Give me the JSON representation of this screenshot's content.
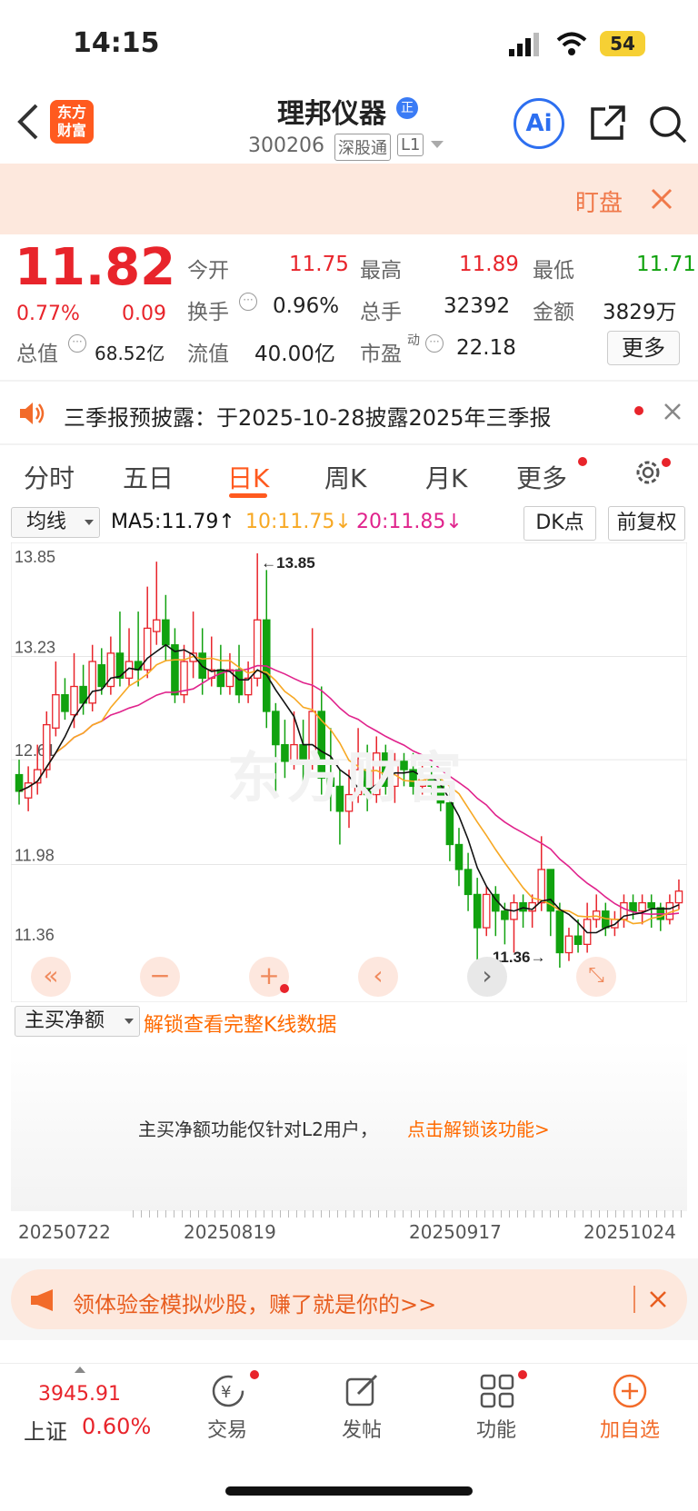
{
  "status_bar": {
    "time": "14:15",
    "battery": "54"
  },
  "header": {
    "title": "理邦仪器",
    "badge": "正",
    "code": "300206",
    "tag1": "深股通",
    "tag2": "L1",
    "logo_line1": "东方",
    "logo_line2": "财富",
    "ai_label": "Ai"
  },
  "banner": {
    "label": "盯盘"
  },
  "quote": {
    "price": "11.82",
    "change_pct": "0.77%",
    "change": "0.09",
    "open_label": "今开",
    "open": "11.75",
    "high_label": "最高",
    "high": "11.89",
    "low_label": "最低",
    "low": "11.71",
    "turnover_label": "换手",
    "turnover": "0.96%",
    "volume_label": "总手",
    "volume": "32392",
    "amount_label": "金额",
    "amount": "3829万",
    "mktcap_label": "总值",
    "mktcap": "68.52亿",
    "float_label": "流值",
    "float": "40.00亿",
    "pe_label": "市盈",
    "pe_sup": "动",
    "pe": "22.18",
    "more_label": "更多"
  },
  "notice": {
    "text": "三季报预披露：于2025-10-28披露2025年三季报"
  },
  "tabs": [
    {
      "label": "分时"
    },
    {
      "label": "五日"
    },
    {
      "label": "日K"
    },
    {
      "label": "周K"
    },
    {
      "label": "月K"
    },
    {
      "label": "更多"
    }
  ],
  "chart_toolbar": {
    "ma_select": "均线",
    "ma5": "MA5:11.79↑",
    "ma10": "10:11.75↓",
    "ma20": "20:11.85↓",
    "dk": "DK点",
    "adjust": "前复权"
  },
  "chart_data": {
    "type": "candlestick",
    "y_ticks": [
      "13.85",
      "13.23",
      "12.61",
      "11.98",
      "11.36"
    ],
    "ylim": [
      11.36,
      13.85
    ],
    "max_label": "←13.85",
    "min_label": "11.36→",
    "x_ticks": [
      "20250722",
      "20250819",
      "20250917",
      "20251024"
    ],
    "colors": {
      "up": "#e8242b",
      "down": "#11a20f",
      "ma5": "#111111",
      "ma10": "#f7a823",
      "ma20": "#e0238c"
    },
    "candles": [
      [
        12.52,
        12.42,
        12.61,
        12.34
      ],
      [
        12.38,
        12.47,
        12.57,
        12.3
      ],
      [
        12.47,
        12.55,
        12.7,
        12.4
      ],
      [
        12.55,
        12.82,
        12.9,
        12.5
      ],
      [
        12.8,
        13.0,
        13.2,
        12.75
      ],
      [
        13.0,
        12.9,
        13.1,
        12.85
      ],
      [
        12.88,
        13.05,
        13.25,
        12.8
      ],
      [
        13.05,
        12.95,
        13.18,
        12.88
      ],
      [
        12.95,
        13.2,
        13.3,
        12.9
      ],
      [
        13.18,
        13.05,
        13.28,
        13.0
      ],
      [
        13.05,
        13.25,
        13.35,
        13.0
      ],
      [
        13.25,
        13.1,
        13.5,
        13.05
      ],
      [
        13.1,
        13.2,
        13.4,
        13.05
      ],
      [
        13.2,
        13.15,
        13.5,
        13.05
      ],
      [
        13.15,
        13.4,
        13.65,
        13.1
      ],
      [
        13.38,
        13.45,
        13.8,
        13.3
      ],
      [
        13.45,
        13.3,
        13.6,
        13.2
      ],
      [
        13.3,
        13.0,
        13.4,
        12.95
      ],
      [
        13.0,
        13.2,
        13.3,
        12.95
      ],
      [
        13.2,
        13.25,
        13.5,
        13.1
      ],
      [
        13.25,
        13.1,
        13.4,
        13.0
      ],
      [
        13.1,
        13.15,
        13.35,
        13.05
      ],
      [
        13.15,
        13.05,
        13.3,
        13.0
      ],
      [
        13.05,
        13.15,
        13.25,
        13.0
      ],
      [
        13.15,
        13.0,
        13.3,
        12.95
      ],
      [
        13.0,
        13.1,
        13.2,
        12.95
      ],
      [
        13.1,
        13.45,
        13.85,
        13.05
      ],
      [
        13.45,
        12.9,
        13.75,
        12.8
      ],
      [
        12.9,
        12.7,
        12.95,
        12.4
      ],
      [
        12.7,
        12.6,
        12.85,
        12.5
      ],
      [
        12.6,
        12.7,
        12.9,
        12.55
      ],
      [
        12.7,
        12.6,
        12.85,
        12.45
      ],
      [
        12.6,
        12.9,
        13.4,
        12.55
      ],
      [
        12.9,
        12.5,
        13.05,
        12.4
      ],
      [
        12.5,
        12.45,
        12.8,
        12.3
      ],
      [
        12.45,
        12.3,
        12.55,
        12.1
      ],
      [
        12.3,
        12.4,
        12.55,
        12.2
      ],
      [
        12.4,
        12.55,
        12.8,
        12.35
      ],
      [
        12.55,
        12.4,
        12.7,
        12.3
      ],
      [
        12.4,
        12.65,
        12.75,
        12.35
      ],
      [
        12.65,
        12.45,
        12.7,
        12.4
      ],
      [
        12.45,
        12.6,
        12.65,
        12.35
      ],
      [
        12.6,
        12.55,
        12.65,
        12.45
      ],
      [
        12.55,
        12.45,
        12.65,
        12.4
      ],
      [
        12.45,
        12.5,
        12.6,
        12.4
      ],
      [
        12.5,
        12.45,
        12.6,
        12.4
      ],
      [
        12.45,
        12.35,
        12.5,
        12.3
      ],
      [
        12.35,
        12.1,
        12.45,
        12.0
      ],
      [
        12.1,
        11.95,
        12.2,
        11.85
      ],
      [
        11.95,
        11.8,
        12.05,
        11.7
      ],
      [
        11.8,
        11.6,
        11.9,
        11.4
      ],
      [
        11.6,
        11.8,
        11.85,
        11.55
      ],
      [
        11.8,
        11.7,
        11.85,
        11.55
      ],
      [
        11.7,
        11.65,
        11.75,
        11.5
      ],
      [
        11.65,
        11.75,
        11.8,
        11.45
      ],
      [
        11.75,
        11.7,
        11.8,
        11.6
      ],
      [
        11.7,
        11.75,
        11.8,
        11.6
      ],
      [
        11.75,
        11.95,
        12.15,
        11.7
      ],
      [
        11.95,
        11.7,
        11.9,
        11.55
      ],
      [
        11.7,
        11.45,
        11.75,
        11.36
      ],
      [
        11.45,
        11.55,
        11.6,
        11.4
      ],
      [
        11.55,
        11.5,
        11.65,
        11.45
      ],
      [
        11.5,
        11.65,
        11.75,
        11.45
      ],
      [
        11.65,
        11.7,
        11.8,
        11.6
      ],
      [
        11.7,
        11.6,
        11.75,
        11.55
      ],
      [
        11.6,
        11.65,
        11.7,
        11.55
      ],
      [
        11.65,
        11.75,
        11.8,
        11.6
      ],
      [
        11.75,
        11.7,
        11.8,
        11.65
      ],
      [
        11.7,
        11.75,
        11.8,
        11.62
      ],
      [
        11.75,
        11.72,
        11.8,
        11.6
      ],
      [
        11.72,
        11.65,
        11.75,
        11.58
      ],
      [
        11.65,
        11.75,
        11.8,
        11.62
      ],
      [
        11.75,
        11.82,
        11.89,
        11.71
      ]
    ]
  },
  "indicator": {
    "select": "主买净额",
    "unlock_link": "解锁查看完整K线数据",
    "message": "主买净额功能仅针对L2用户，",
    "message_link": "点击解锁该功能>"
  },
  "promo": {
    "text": "领体验金模拟炒股，赚了就是你的>>"
  },
  "bottom_bar": {
    "index_value": "3945.91",
    "index_name": "上证",
    "index_change": "0.60%",
    "items": [
      {
        "label": "交易"
      },
      {
        "label": "发帖"
      },
      {
        "label": "功能"
      },
      {
        "label": "加自选"
      }
    ]
  },
  "icons": {
    "back": "back-arrow-icon",
    "share": "share-icon",
    "search": "search-icon",
    "speaker": "speaker-icon",
    "gear": "gear-icon",
    "close": "close-icon"
  }
}
